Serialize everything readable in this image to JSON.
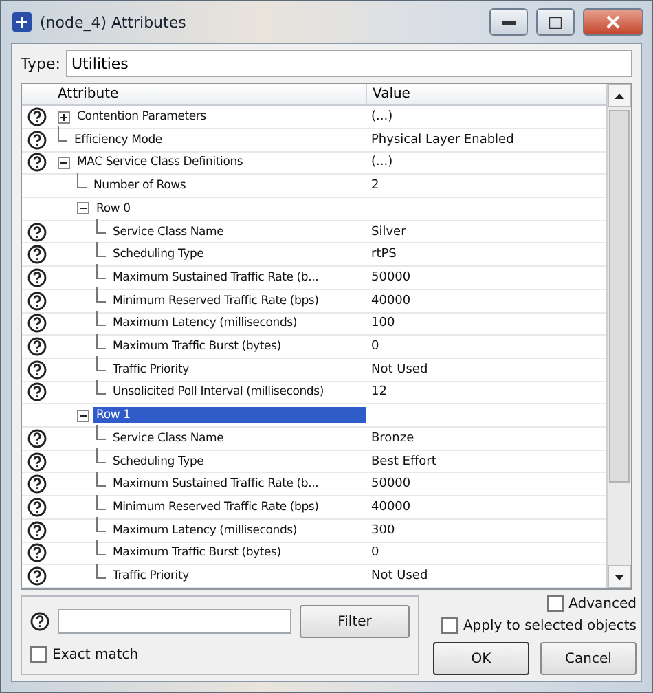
{
  "window": {
    "title": "(node_4) Attributes"
  },
  "type_field": {
    "label": "Type:",
    "value": "Utilities"
  },
  "table": {
    "columns": [
      "Attribute",
      "Value"
    ],
    "rows": [
      {
        "name": "Contention Parameters",
        "value": "(...)",
        "help": true,
        "expanded": false,
        "selected": false
      },
      {
        "name": "Efficiency Mode",
        "value": "Physical Layer Enabled",
        "help": true,
        "selected": false
      },
      {
        "name": "MAC Service Class Definitions",
        "value": "(...)",
        "help": true,
        "expanded": true,
        "selected": false,
        "children": [
          {
            "name": "Number of Rows",
            "value": "2",
            "help": false,
            "selected": false
          },
          {
            "name": "Row 0",
            "help": false,
            "expanded": true,
            "selected": false,
            "children": [
              {
                "name": "Service Class Name",
                "value": "Silver",
                "help": true,
                "selected": false
              },
              {
                "name": "Scheduling Type",
                "value": "rtPS",
                "help": true,
                "selected": false
              },
              {
                "name": "Maximum Sustained Traffic Rate (b...",
                "value": "50000",
                "help": true,
                "selected": false
              },
              {
                "name": "Minimum Reserved Traffic Rate (bps)",
                "value": "40000",
                "help": true,
                "selected": false
              },
              {
                "name": "Maximum Latency (milliseconds)",
                "value": "100",
                "help": true,
                "selected": false
              },
              {
                "name": "Maximum Traffic Burst (bytes)",
                "value": "0",
                "help": true,
                "selected": false
              },
              {
                "name": "Traffic Priority",
                "value": "Not Used",
                "help": true,
                "selected": false
              },
              {
                "name": "Unsolicited Poll Interval (milliseconds)",
                "value": "12",
                "help": true,
                "selected": false
              }
            ]
          },
          {
            "name": "Row 1",
            "help": false,
            "expanded": true,
            "selected": true,
            "children": [
              {
                "name": "Service Class Name",
                "value": "Bronze",
                "help": true,
                "selected": false
              },
              {
                "name": "Scheduling Type",
                "value": "Best Effort",
                "help": true,
                "selected": false
              },
              {
                "name": "Maximum Sustained Traffic Rate (b...",
                "value": "50000",
                "help": true,
                "selected": false
              },
              {
                "name": "Minimum Reserved Traffic Rate (bps)",
                "value": "40000",
                "help": true,
                "selected": false
              },
              {
                "name": "Maximum Latency (milliseconds)",
                "value": "300",
                "help": true,
                "selected": false
              },
              {
                "name": "Maximum Traffic Burst (bytes)",
                "value": "0",
                "help": true,
                "selected": false
              },
              {
                "name": "Traffic Priority",
                "value": "Not Used",
                "help": true,
                "selected": false
              }
            ]
          }
        ]
      }
    ]
  },
  "filter": {
    "button": "Filter",
    "exact_match": {
      "label": "Exact match",
      "checked": false
    }
  },
  "advanced": {
    "label": "Advanced",
    "checked": false
  },
  "apply_selected": {
    "label": "Apply to selected objects",
    "checked": false
  },
  "buttons": [
    "OK",
    "Cancel"
  ]
}
